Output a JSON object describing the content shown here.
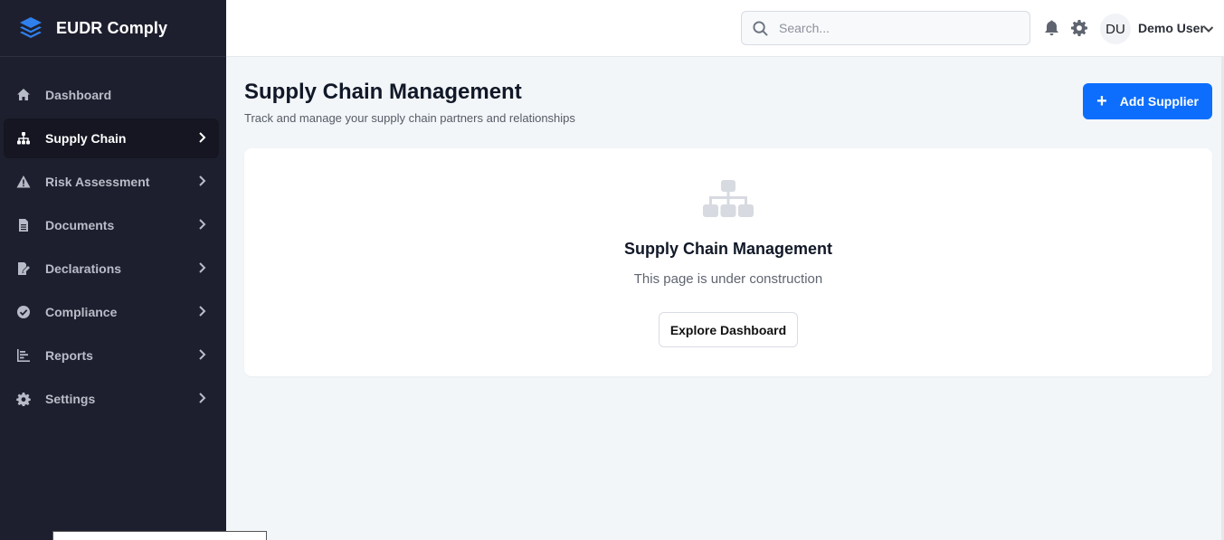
{
  "app": {
    "name": "EUDR Comply"
  },
  "sidebar": {
    "items": [
      {
        "label": "Dashboard",
        "icon": "home-icon"
      },
      {
        "label": "Supply Chain",
        "icon": "sitemap-icon",
        "active": true
      },
      {
        "label": "Risk Assessment",
        "icon": "warning-icon"
      },
      {
        "label": "Documents",
        "icon": "file-icon"
      },
      {
        "label": "Declarations",
        "icon": "file-signature-icon"
      },
      {
        "label": "Compliance",
        "icon": "check-circle-icon"
      },
      {
        "label": "Reports",
        "icon": "chart-bar-icon"
      },
      {
        "label": "Settings",
        "icon": "gear-icon"
      }
    ],
    "tooltip": ""
  },
  "topbar": {
    "search_placeholder": "Search...",
    "avatar_initials": "DU",
    "user_name": "Demo User"
  },
  "main": {
    "title": "Supply Chain Management",
    "subtitle": "Track and manage your supply chain partners and relationships",
    "add_button_label": "Add Supplier",
    "card": {
      "title": "Supply Chain Management",
      "text": "This page is under construction",
      "button_label": "Explore Dashboard"
    }
  },
  "colors": {
    "sidebar_bg": "#1e1f2e",
    "primary": "#0d6efd",
    "brand_logo": "#1a73e8"
  }
}
